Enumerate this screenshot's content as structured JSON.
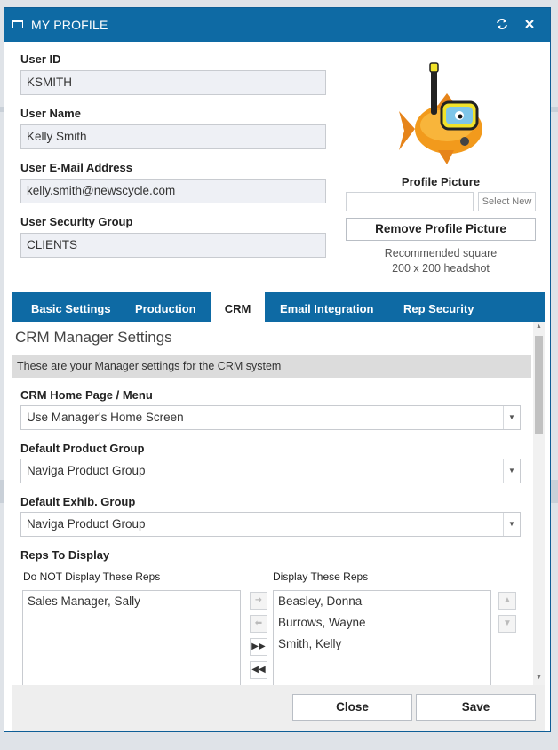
{
  "dialog": {
    "title": "MY PROFILE",
    "refresh_icon": "refresh-icon",
    "close_icon": "close-icon"
  },
  "fields": {
    "user_id_label": "User ID",
    "user_id_value": "KSMITH",
    "user_name_label": "User Name",
    "user_name_value": "Kelly Smith",
    "email_label": "User E-Mail Address",
    "email_value": "kelly.smith@newscycle.com",
    "security_label": "User Security Group",
    "security_value": "CLIENTS"
  },
  "profile_picture": {
    "label": "Profile Picture",
    "file_value": "",
    "select_label": "Select New",
    "remove_label": "Remove Profile Picture",
    "note_line1": "Recommended square",
    "note_line2": "200 x 200 headshot"
  },
  "tabs": [
    {
      "label": "Basic Settings",
      "active": false
    },
    {
      "label": "Production",
      "active": false
    },
    {
      "label": "CRM",
      "active": true
    },
    {
      "label": "Email Integration",
      "active": false
    },
    {
      "label": "Rep Security",
      "active": false
    }
  ],
  "crm": {
    "title": "CRM Manager Settings",
    "description": "These are your Manager settings for the CRM system",
    "home_label": "CRM Home Page / Menu",
    "home_value": "Use Manager's Home Screen",
    "product_label": "Default Product Group",
    "product_value": "Naviga Product Group",
    "exhib_label": "Default Exhib. Group",
    "exhib_value": "Naviga Product Group",
    "reps_label": "Reps To Display",
    "hidden_label": "Do NOT Display These Reps",
    "hidden_reps": [
      "Sales Manager, Sally"
    ],
    "shown_label": "Display These Reps",
    "shown_reps": [
      "Beasley, Donna",
      "Burrows, Wayne",
      "Smith, Kelly"
    ]
  },
  "footer": {
    "close_label": "Close",
    "save_label": "Save"
  },
  "colors": {
    "accent": "#0e6aa4",
    "description_bar": "#dcdcdc"
  }
}
